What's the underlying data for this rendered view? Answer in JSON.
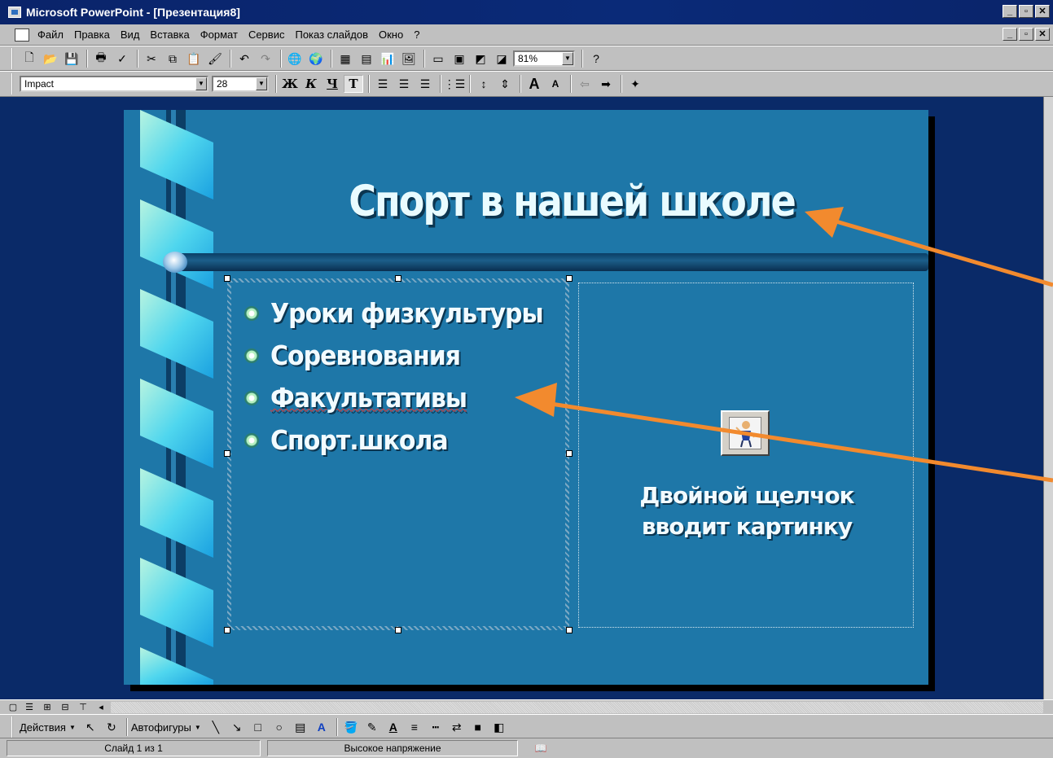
{
  "window": {
    "title": "Microsoft PowerPoint - [Презентация8]",
    "minimize": "_",
    "restore": "▫",
    "close": "✕"
  },
  "menu": {
    "items": [
      "Файл",
      "Правка",
      "Вид",
      "Вставка",
      "Формат",
      "Сервис",
      "Показ слайдов",
      "Окно",
      "?"
    ]
  },
  "standard_toolbar": {
    "zoom": "81%"
  },
  "format_toolbar": {
    "font": "Impact",
    "size": "28",
    "bold": "Ж",
    "italic": "К",
    "underline": "Ч",
    "shadow": "T"
  },
  "slide": {
    "title": "Спорт в нашей школе",
    "bullets": [
      "Уроки физкультуры",
      "Соревнования",
      "Факультативы",
      "Спорт.школа"
    ],
    "picture_placeholder": {
      "line1": "Двойной щелчок",
      "line2": "вводит картинку"
    }
  },
  "drawing_toolbar": {
    "actions": "Действия",
    "autoshapes": "Автофигуры"
  },
  "status": {
    "slide": "Слайд 1 из 1",
    "design": "Высокое напряжение"
  },
  "colors": {
    "slide_bg": "#1e77a8",
    "arrow": "#f28a2e",
    "desktop": "#0a2a68"
  },
  "icons": [
    "new-icon",
    "open-icon",
    "save-icon",
    "print-icon",
    "spell-icon",
    "cut-icon",
    "copy-icon",
    "paste-icon",
    "format-painter-icon",
    "undo-icon",
    "redo-icon",
    "hyperlink-icon",
    "web-icon",
    "table-icon",
    "excel-icon",
    "chart-icon",
    "clipart-icon",
    "new-slide-icon",
    "layout-icon",
    "background-icon",
    "grayscale-icon",
    "help-icon"
  ]
}
